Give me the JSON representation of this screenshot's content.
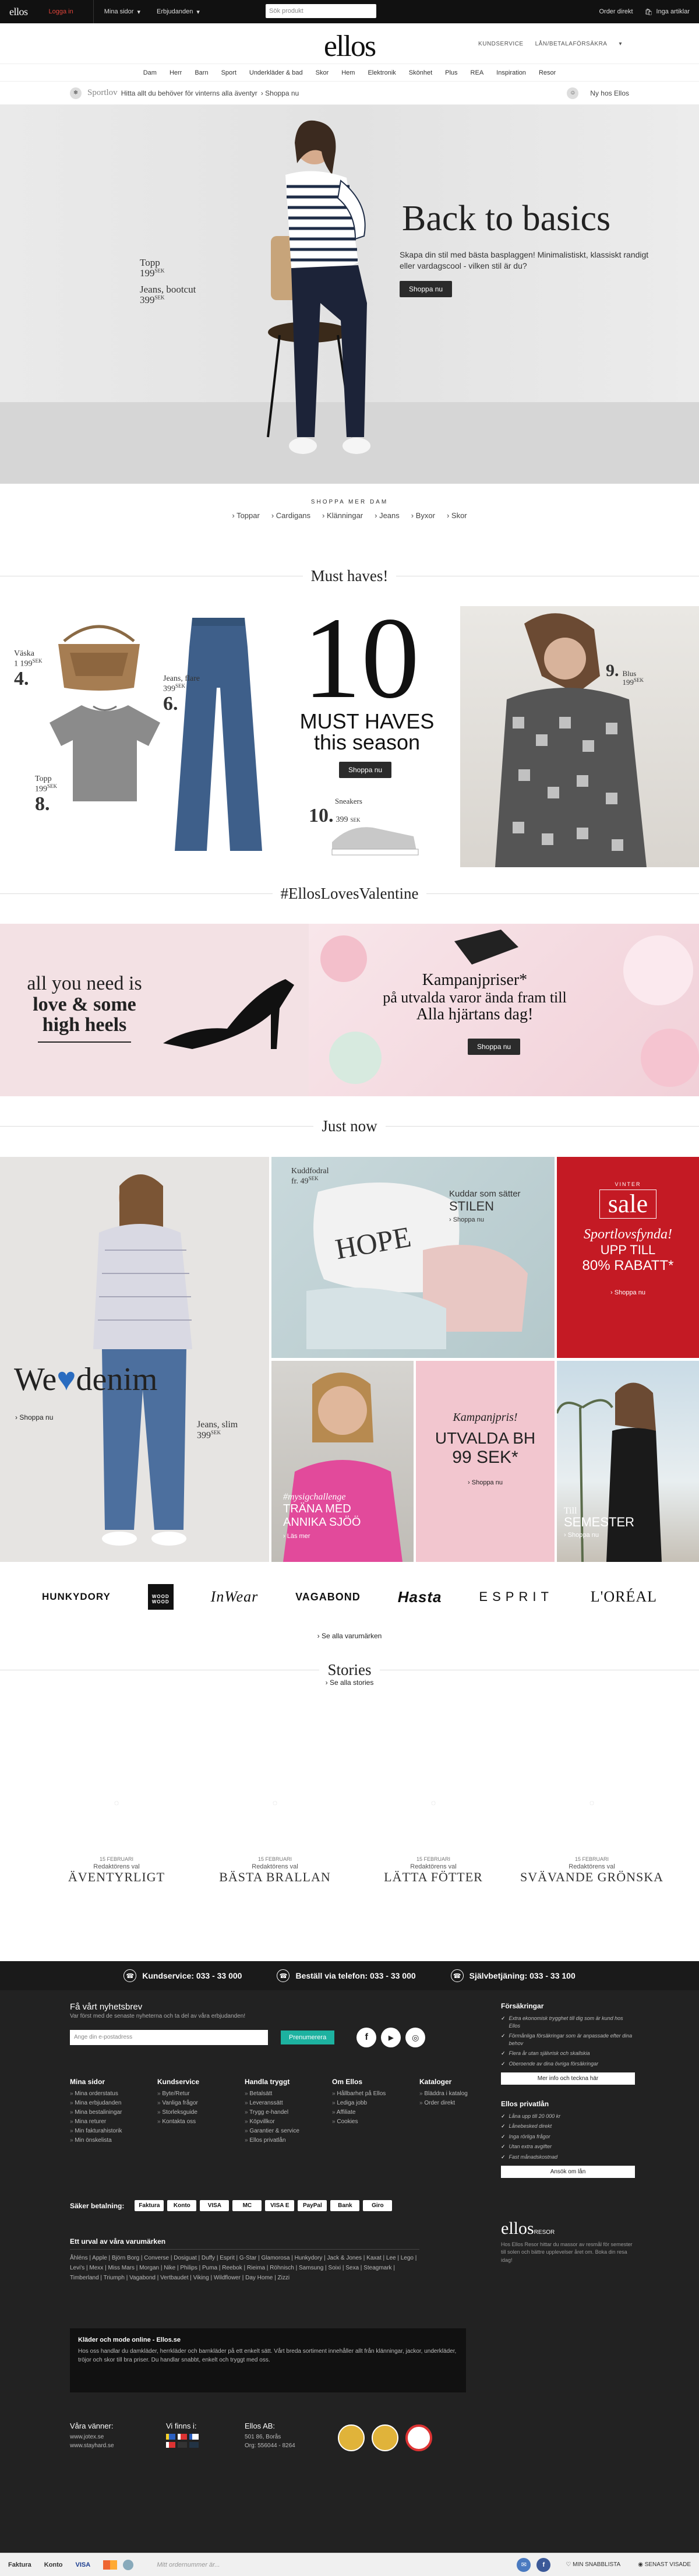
{
  "topbar": {
    "logo": "ellos",
    "login": "Logga in",
    "mina_sidor": "Mina sidor",
    "erbjudanden": "Erbjudanden",
    "search_placeholder": "Sök produkt",
    "kundvagn": "Inga artiklar",
    "order": "Order direkt"
  },
  "header": {
    "logo": "ellos",
    "kundservice": "KUNDSERVICE",
    "lan": "LÅN/BETALAFÖRSÄKRA"
  },
  "nav": [
    "Dam",
    "Herr",
    "Barn",
    "Sport",
    "Underkläder & bad",
    "Skor",
    "Hem",
    "Elektronik",
    "Skönhet",
    "Plus",
    "REA",
    "Inspiration",
    "Resor"
  ],
  "promo": {
    "label": "Sportlov",
    "text": "Hitta allt du behöver för vinterns alla äventyr",
    "link": "› Shoppa nu",
    "right": "Ny hos Ellos"
  },
  "hero": {
    "title": "Back to basics",
    "sub": "Skapa din stil med bästa basplaggen! Minimalistiskt, klassiskt randigt eller vardagscool - vilken stil är du?",
    "cta": "Shoppa nu",
    "tag1_name": "Topp",
    "tag1_price": "199",
    "tag2_name": "Jeans, bootcut",
    "tag2_price": "399",
    "currency": "SEK"
  },
  "shopmore": {
    "label": "SHOPPA MER DAM",
    "cats": [
      "› Toppar",
      "› Cardigans",
      "› Klänningar",
      "› Jeans",
      "› Byxor",
      "› Skor"
    ]
  },
  "musthaves": {
    "section": "Must haves!",
    "big": "10",
    "title_line1": "MUST HAVES",
    "title_line2": "this season",
    "cta": "Shoppa nu",
    "items": [
      {
        "num": "4.",
        "name": "Väska",
        "price": "1 199"
      },
      {
        "num": "6.",
        "name": "Jeans, flare",
        "price": "399"
      },
      {
        "num": "8.",
        "name": "Topp",
        "price": "199"
      },
      {
        "num": "10.",
        "name": "Sneakers",
        "price": "399"
      },
      {
        "num": "9.",
        "name": "Blus",
        "price": "199"
      }
    ],
    "currency": "SEK"
  },
  "valentine": {
    "section": "#EllosLovesValentine",
    "quote1": "all you need is",
    "quote2": "love & some",
    "quote3": "high heels",
    "kampanj1": "Kampanjpriser*",
    "kampanj2": "på utvalda varor ända fram till",
    "kampanj3": "Alla hjärtans dag!",
    "cta": "Shoppa nu"
  },
  "justnow": {
    "section": "Just now",
    "denim_title1": "We",
    "denim_title2": "denim",
    "denim_link": "› Shoppa nu",
    "denim_tag_name": "Jeans, slim",
    "denim_tag_price": "399",
    "kudd_name": "Kuddfodral",
    "kudd_price": "fr. 49",
    "kudd_title1": "Kuddar som sätter",
    "kudd_title2": "STILEN",
    "kudd_link": "› Shoppa nu",
    "sale_small": "VINTER",
    "sale_big": "sale",
    "sale_script": "Sportlovsfynda!",
    "sale_line1": "UPP TILL",
    "sale_line2": "80% RABATT*",
    "sale_link": "› Shoppa nu",
    "annika1": "#mysigchallenge",
    "annika2": "TRÄNA MED",
    "annika3": "ANNIKA SJÖÖ",
    "annika_link": "› Läs mer",
    "bh_script": "Kampanjpris!",
    "bh_line1": "UTVALDA BH",
    "bh_line2": "99 SEK*",
    "bh_link": "› Shoppa nu",
    "semester1": "Till",
    "semester2": "SEMESTER",
    "semester_link": "› Shoppa nu"
  },
  "brands": {
    "items": [
      "HUNKYDORY",
      "WOOD WOOD",
      "InWear",
      "VAGABOND",
      "Hasta",
      "ESPRIT",
      "L'ORÉAL"
    ],
    "link": "› Se alla varumärken"
  },
  "stories": {
    "section": "Stories",
    "link": "› Se alla stories",
    "items": [
      {
        "date": "15 FEBRUARI",
        "editor": "Redaktörens val",
        "title": "ÄVENTYRLIGT"
      },
      {
        "date": "15 FEBRUARI",
        "editor": "Redaktörens val",
        "title": "BÄSTA BRALLAN"
      },
      {
        "date": "15 FEBRUARI",
        "editor": "Redaktörens val",
        "title": "LÄTTA FÖTTER"
      },
      {
        "date": "15 FEBRUARI",
        "editor": "Redaktörens val",
        "title": "SVÄVANDE GRÖNSKA"
      }
    ]
  },
  "footer": {
    "kundservice": "Kundservice: 033 - 33 000",
    "bestall": "Beställ via telefon: 033 - 33 000",
    "sjalv": "Självbetjäning: 033 - 33 100",
    "newsletter_title": "Få vårt nyhetsbrev",
    "newsletter_sub": "Var först med de senaste nyheterna och ta del av våra erbjudanden!",
    "email_placeholder": "Ange din e-postadress",
    "prenumerera": "Prenumerera",
    "cols": [
      {
        "h": "Mina sidor",
        "items": [
          "Mina orderstatus",
          "Mina erbjudanden",
          "Mina bestaliningar",
          "Mina returer",
          "Min fakturahistorik",
          "Min önskelista"
        ]
      },
      {
        "h": "Kundservice",
        "items": [
          "Byte/Retur",
          "Vanliga frågor",
          "Storleksguide",
          "Kontakta oss"
        ]
      },
      {
        "h": "Handla tryggt",
        "items": [
          "Betalsätt",
          "Leveranssätt",
          "Trygg e-handel",
          "Köpvillkor",
          "Garantier & service",
          "Ellos privatlån"
        ]
      },
      {
        "h": "Om Ellos",
        "items": [
          "Hållbarhet på Ellos",
          "Lediga jobb",
          "Affiliate",
          "Cookies"
        ]
      },
      {
        "h": "Kataloger",
        "items": [
          "Bläddra i katalog",
          "Order direkt"
        ]
      }
    ],
    "forsakringar_title": "Försäkringar",
    "forsakringar": [
      "Extra ekonomisk trygghet till dig som är kund hos Ellos",
      "Förmånliga försäkringar som är anpassade efter dina behov",
      "Flera år utan självrisk och skallskia",
      "Oberoende av dina övriga försäkringar"
    ],
    "forsakringar_btn": "Mer info och teckna här",
    "privatlan_title": "Ellos privatlån",
    "privatlan": [
      "Låna upp till 20 000 kr",
      "Lånebesked direkt",
      "Inga rörliga frågor",
      "Utan extra avgifter",
      "Fast månadskostnad"
    ],
    "privatlan_btn": "Ansök om lån",
    "saker_betalning": "Säker betalning:",
    "payments": [
      "Faktura",
      "Konto",
      "VISA",
      "MC",
      "VISA E",
      "PayPal",
      "Bank",
      "Giro"
    ],
    "brands_title": "Ett urval av våra varumärken",
    "brands_text": "Åhléns | Apple | Björn Borg | Converse | Dosiguat | Duffy | Esprit | G-Star | Glamorosa | Hunkydory | Jack & Jones | Kaxat | Lee | Lego | Levi's | Mexx | Miss Mars | Morgan | Nike | Philips | Puma | Reebok | Rieima | Röhnisch | Samsung | Soixi | Sexa | Steagmark | Timberland | Triumph | Vagabond | Vertbaudet | Viking | Wildflower | Day Home | Zizzi",
    "about_title": "Kläder och mode online - Ellos.se",
    "about_text": "Hos oss handlar du damkläder, herrkläder och barnkläder på ett enkelt sätt. Vårt breda sortiment innehåller allt från klänningar, jackor, underkläder, tröjor och skor till bra priser. Du handlar snabbt, enkelt och tryggt med oss.",
    "friends_title": "Våra vänner:",
    "friends": [
      "www.jotex.se",
      "www.stayhard.se"
    ],
    "vi_finns": "Vi finns i:",
    "ellos_ab": "Ellos AB:",
    "ellos_addr": [
      "501 86, Borås",
      "Org: 556044 - 8264"
    ],
    "ellos_resor": "ellos",
    "ellos_resor_small": "RESOR",
    "resor_text": "Hos Ellos Resor hittar du massor av resmål för semester till solen och bättre upplevelser året om. Boka din resa idag!"
  },
  "bottombar": {
    "faktura": "Faktura",
    "konto": "Konto",
    "search_placeholder": "Mitt ordernummer är...",
    "minsida": "MIN SNABBLISTA",
    "senast": "SENAST VISADE"
  },
  "colors": {
    "accent": "#e0443a",
    "dark": "#222222",
    "sale_red": "#c41a24",
    "teal": "#1db2a0"
  }
}
